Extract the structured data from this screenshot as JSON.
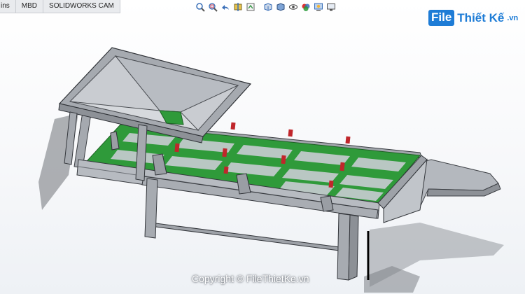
{
  "command_manager": {
    "tabs": [
      {
        "label": "ins"
      },
      {
        "label": "MBD"
      },
      {
        "label": "SOLIDWORKS CAM"
      }
    ]
  },
  "heads_up_toolbar": {
    "icons": [
      "zoom-to-fit-icon",
      "zoom-to-area-icon",
      "previous-view-icon",
      "section-view-icon",
      "dynamic-annotation-icon",
      "view-orientation-icon",
      "display-style-icon",
      "hide-show-items-icon",
      "edit-appearance-icon",
      "apply-scene-icon",
      "view-settings-icon"
    ]
  },
  "watermark": {
    "logo_box": "File",
    "logo_rest": "Thiết Kế",
    "logo_tld": ".vn",
    "copyright": "Copyright © FileThietKe.vn"
  },
  "colors": {
    "accent": "#1e7cd6",
    "model_gray": "#a9adb3",
    "model_green": "#2f9a3a",
    "model_red": "#c0262b"
  }
}
